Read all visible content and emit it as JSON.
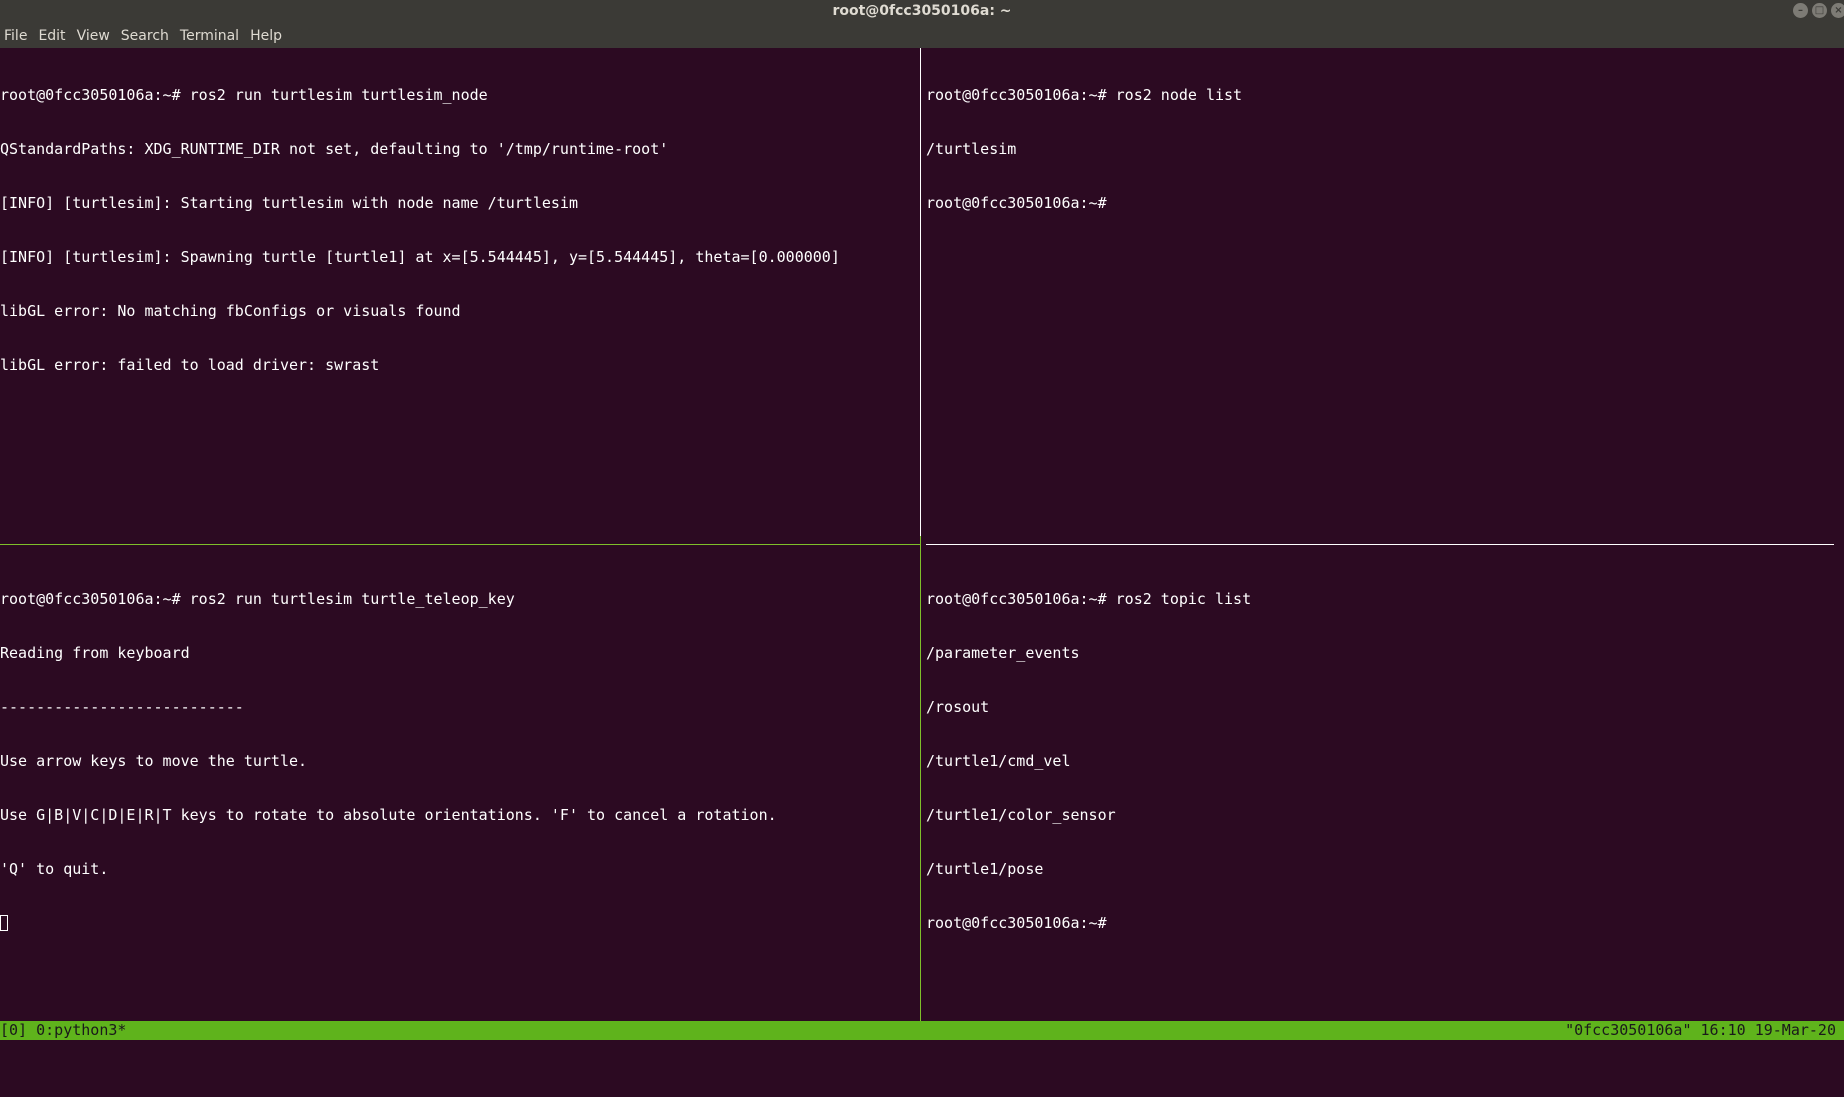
{
  "window": {
    "title": "root@0fcc3050106a: ~"
  },
  "menu": {
    "items": [
      "File",
      "Edit",
      "View",
      "Search",
      "Terminal",
      "Help"
    ]
  },
  "panes": {
    "top_left": [
      "root@0fcc3050106a:~# ros2 run turtlesim turtlesim_node",
      "QStandardPaths: XDG_RUNTIME_DIR not set, defaulting to '/tmp/runtime-root'",
      "[INFO] [turtlesim]: Starting turtlesim with node name /turtlesim",
      "[INFO] [turtlesim]: Spawning turtle [turtle1] at x=[5.544445], y=[5.544445], theta=[0.000000]",
      "libGL error: No matching fbConfigs or visuals found",
      "libGL error: failed to load driver: swrast"
    ],
    "top_right": [
      "root@0fcc3050106a:~# ros2 node list",
      "/turtlesim",
      "root@0fcc3050106a:~# "
    ],
    "bottom_left": [
      "root@0fcc3050106a:~# ros2 run turtlesim turtle_teleop_key",
      "Reading from keyboard",
      "---------------------------",
      "Use arrow keys to move the turtle.",
      "Use G|B|V|C|D|E|R|T keys to rotate to absolute orientations. 'F' to cancel a rotation.",
      "'Q' to quit."
    ],
    "bottom_right": [
      "root@0fcc3050106a:~# ros2 topic list",
      "/parameter_events",
      "/rosout",
      "/turtle1/cmd_vel",
      "/turtle1/color_sensor",
      "/turtle1/pose",
      "root@0fcc3050106a:~# "
    ]
  },
  "status": {
    "left": "[0] 0:python3*",
    "right": "\"0fcc3050106a\" 16:10 19-Mar-20"
  },
  "colors": {
    "terminal_bg": "#2c0a22",
    "status_bg": "#5fb31c",
    "active_divider": "#7fbf2a"
  }
}
